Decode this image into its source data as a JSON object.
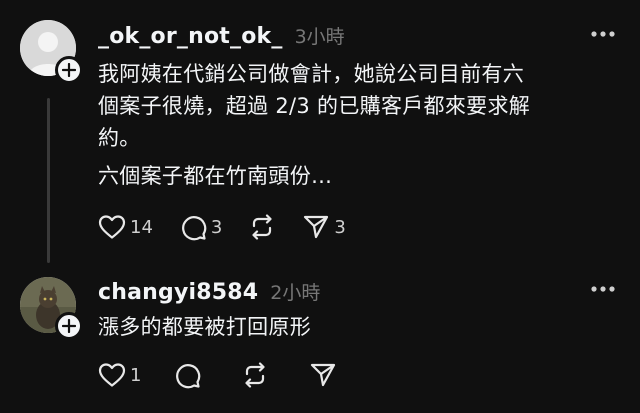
{
  "posts": [
    {
      "username": "_ok_or_not_ok_",
      "time": "3小時",
      "avatar_icon": "default-avatar-icon",
      "paragraphs": [
        "我阿姨在代銷公司做會計，她說公司目前有六",
        "個案子很燒，超過 2/3 的已購客戶都來要求解",
        "約。",
        "六個案子都在竹南頭份…"
      ],
      "actions": {
        "like_count": "14",
        "comment_count": "3",
        "repost_count": "",
        "share_count": "3"
      }
    },
    {
      "username": "changyi8584",
      "time": "2小時",
      "avatar_icon": "cat-photo-avatar",
      "paragraphs": [
        "漲多的都要被打回原形"
      ],
      "actions": {
        "like_count": "1",
        "comment_count": "",
        "repost_count": "",
        "share_count": ""
      }
    }
  ],
  "colors": {
    "background": "#101010",
    "text": "#f3f5f7",
    "muted": "#777777",
    "thread_line": "#3a3a3a"
  }
}
